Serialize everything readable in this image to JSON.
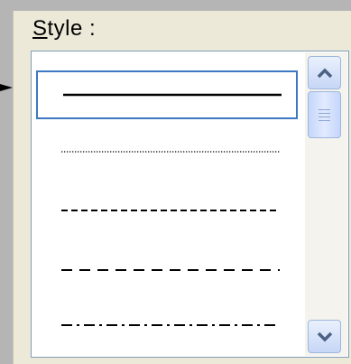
{
  "label": {
    "mnemonic": "S",
    "rest": "tyle :"
  },
  "line_styles": [
    {
      "name": "solid",
      "selected": true
    },
    {
      "name": "dotted",
      "selected": false
    },
    {
      "name": "dashed",
      "selected": false
    },
    {
      "name": "long-dash",
      "selected": false
    },
    {
      "name": "dash-dot",
      "selected": false
    }
  ],
  "colors": {
    "selection_border": "#3e77c2",
    "listbox_border": "#7f9db9",
    "dialog_background": "#ece9d8",
    "backdrop": "#b5b5b5"
  },
  "icons": {
    "callout": "arrow-right-icon",
    "scroll_up": "chevron-up-icon",
    "scroll_down": "chevron-down-icon"
  }
}
